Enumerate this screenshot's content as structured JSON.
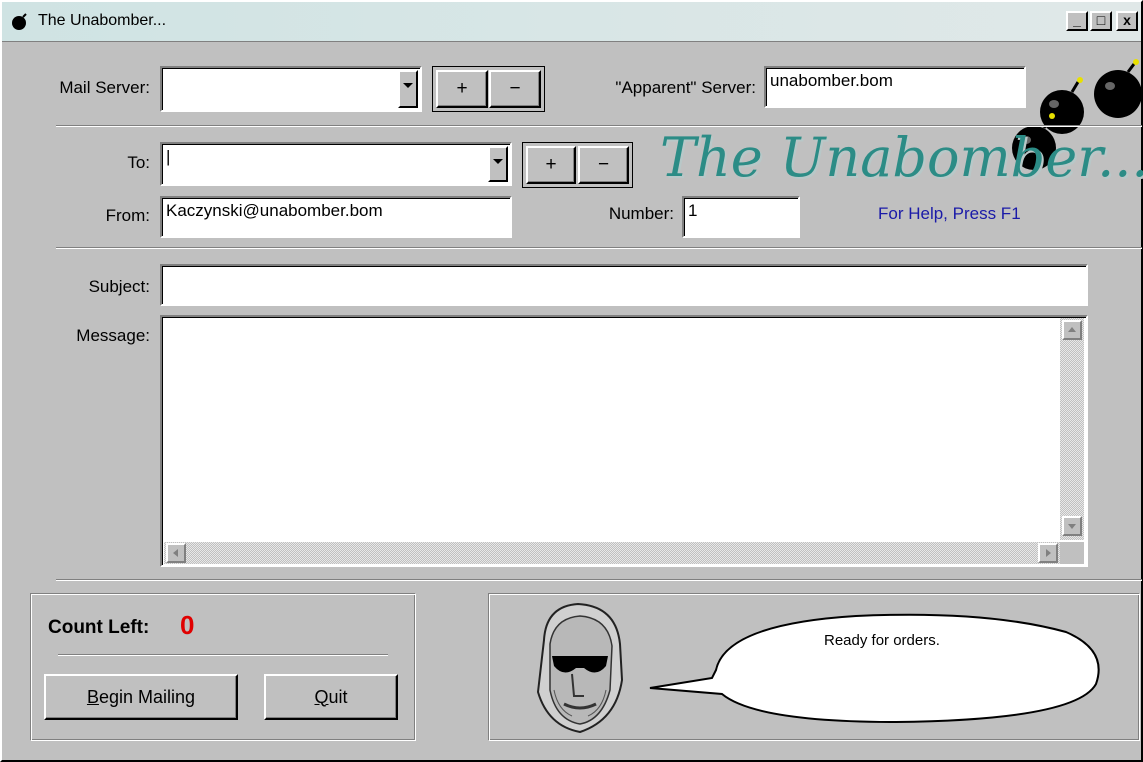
{
  "window": {
    "title": "The Unabomber...",
    "controls": {
      "minimize": "_",
      "maximize": "□",
      "close": "x"
    }
  },
  "server": {
    "mail_server_label": "Mail Server:",
    "mail_server_value": "",
    "add_label": "+",
    "remove_label": "−",
    "apparent_label": "\"Apparent\" Server:",
    "apparent_value": "unabomber.bom"
  },
  "recipient": {
    "to_label": "To:",
    "to_value": "|",
    "add_label": "+",
    "remove_label": "−",
    "from_label": "From:",
    "from_value": "Kaczynski@unabomber.bom",
    "number_label": "Number:",
    "number_value": "1"
  },
  "branding": {
    "logo_text": "The Unabomber...",
    "help_text": "For Help, Press F1"
  },
  "message": {
    "subject_label": "Subject:",
    "subject_value": "",
    "message_label": "Message:",
    "message_value": ""
  },
  "status": {
    "count_left_label": "Count Left:",
    "count_left_value": "0",
    "begin_label": "Begin Mailing",
    "quit_label": "Quit",
    "speech": "Ready for orders."
  },
  "icons": [
    "bomb-icon",
    "minimize-icon",
    "maximize-icon",
    "close-icon",
    "chevron-down-icon",
    "scroll-up-icon",
    "scroll-down-icon",
    "scroll-left-icon",
    "scroll-right-icon"
  ],
  "colors": {
    "logo": "#2c8c86",
    "help": "#1a1aa8",
    "count": "#e00000",
    "face": "#c0c0c0"
  }
}
